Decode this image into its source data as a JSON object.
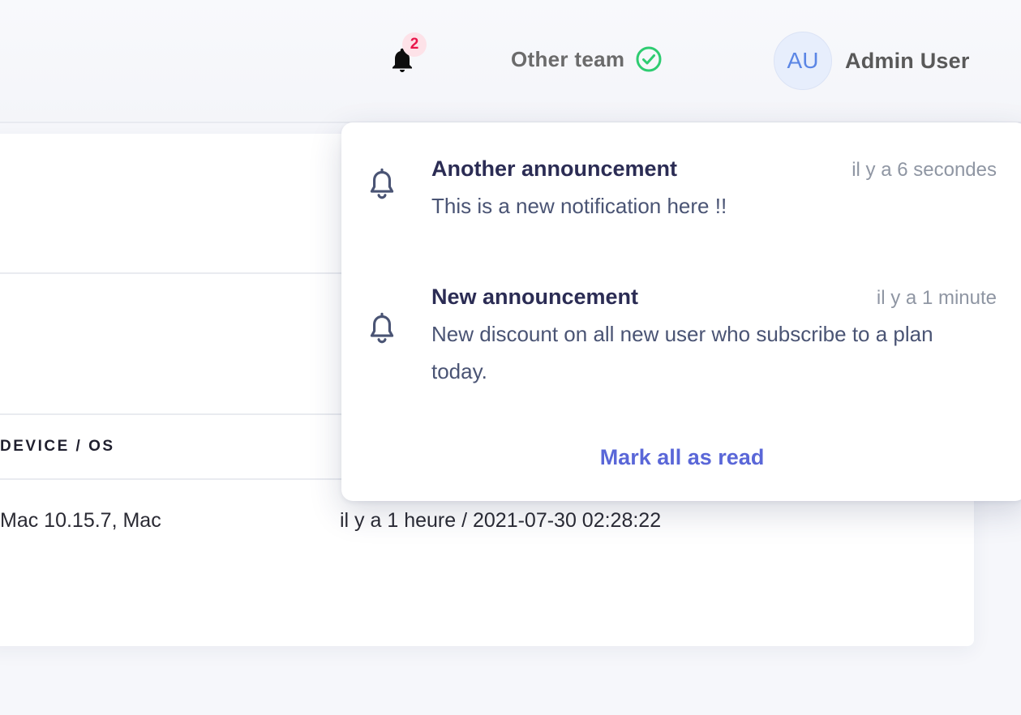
{
  "header": {
    "notification_count": "2",
    "team": {
      "name": "Other team",
      "status_color": "#2ecc71"
    },
    "user": {
      "initials": "AU",
      "name": "Admin User"
    }
  },
  "sessions_table": {
    "columns": [
      "DEVICE / OS",
      ""
    ],
    "rows": [
      [
        "Mac 10.15.7, Mac",
        "il y a 1 heure / 2021-07-30 02:28:22"
      ]
    ]
  },
  "notifications": {
    "items": [
      {
        "title": "Another announcement",
        "time": "il y a 6 secondes",
        "body": "This is a new notification here !!",
        "icon": "bell-outline-icon"
      },
      {
        "title": "New announcement",
        "time": "il y a 1 minute",
        "body": "New discount on all new user who subscribe to a plan today.",
        "icon": "bell-outline-icon"
      }
    ],
    "mark_all_label": "Mark all as read"
  },
  "colors": {
    "accent": "#5a67d8",
    "badge": "#e8174b",
    "badge_bg": "#fde2e8",
    "title_text": "#2b2c54"
  }
}
